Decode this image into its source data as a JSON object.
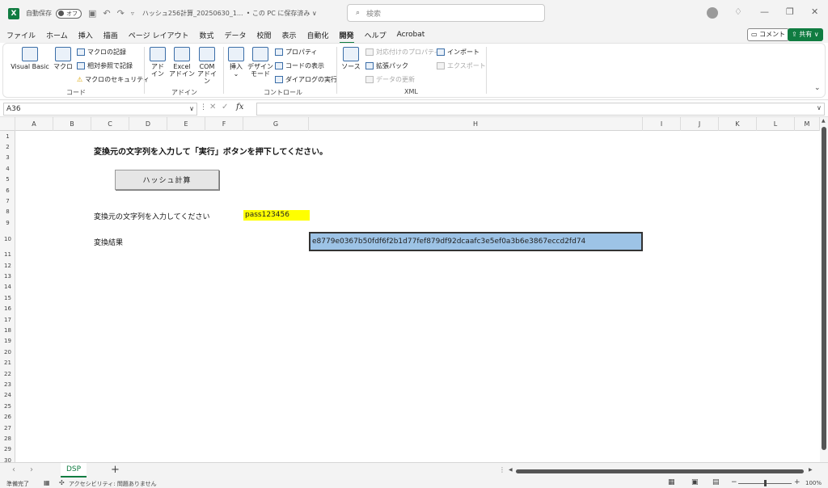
{
  "titlebar": {
    "autosave_label": "自動保存",
    "autosave_state": "オフ",
    "file_name": "ハッシュ256計算_20250630_1...",
    "save_location": "• この PC に保存済み ∨",
    "search_placeholder": "検索"
  },
  "tabs": [
    "ファイル",
    "ホーム",
    "挿入",
    "描画",
    "ページ レイアウト",
    "数式",
    "データ",
    "校閲",
    "表示",
    "自動化",
    "開発",
    "ヘルプ",
    "Acrobat"
  ],
  "active_tab": "開発",
  "comment_label": "コメント",
  "share_label": "共有",
  "ribbon": {
    "code": {
      "label": "コード",
      "visual_basic": "Visual Basic",
      "macro": "マクロ",
      "record_macro": "マクロの記録",
      "relative_ref": "相対参照で記録",
      "macro_security": "マクロのセキュリティ"
    },
    "addins": {
      "label": "アドイン",
      "addin_line1": "アド",
      "addin_line2": "イン",
      "excel_addin_line1": "Excel",
      "excel_addin_line2": "アドイン",
      "com_addin_line1": "COM",
      "com_addin_line2": "アドイン"
    },
    "controls": {
      "label": "コントロール",
      "insert": "挿入",
      "design_line1": "デザイン",
      "design_line2": "モード",
      "properties": "プロパティ",
      "view_code": "コードの表示",
      "run_dialog": "ダイアログの実行"
    },
    "xml": {
      "label": "XML",
      "source": "ソース",
      "map_props": "対応付けのプロパティ",
      "expansion_pack": "拡張パック",
      "refresh_data": "データの更新",
      "import": "インポート",
      "export": "エクスポート"
    }
  },
  "namebox": "A36",
  "columns": [
    "A",
    "B",
    "C",
    "D",
    "E",
    "F",
    "G",
    "H",
    "I",
    "J",
    "K",
    "L",
    "M"
  ],
  "rows": [
    "1",
    "2",
    "3",
    "4",
    "5",
    "6",
    "7",
    "8",
    "9",
    "10",
    "11",
    "12",
    "13",
    "14",
    "15",
    "16",
    "17",
    "18",
    "19",
    "20",
    "21",
    "22",
    "23",
    "24",
    "25",
    "26",
    "27",
    "28",
    "29",
    "30"
  ],
  "sheet": {
    "instruction": "変換元の文字列を入力して「実行」ボタンを押下してください。",
    "button_label": "ハッシュ計算",
    "input_label": "変換元の文字列を入力してください",
    "input_value": "pass123456",
    "result_label": "変換結果",
    "result_value": "e8779e0367b50fdf6f2b1d77fef879df92dcaafc3e5ef0a3b6e3867eccd2fd74"
  },
  "sheet_tabs": [
    "DSP"
  ],
  "status": {
    "ready": "準備完了",
    "accessibility": "アクセシビリティ: 問題ありません",
    "zoom": "100%"
  }
}
